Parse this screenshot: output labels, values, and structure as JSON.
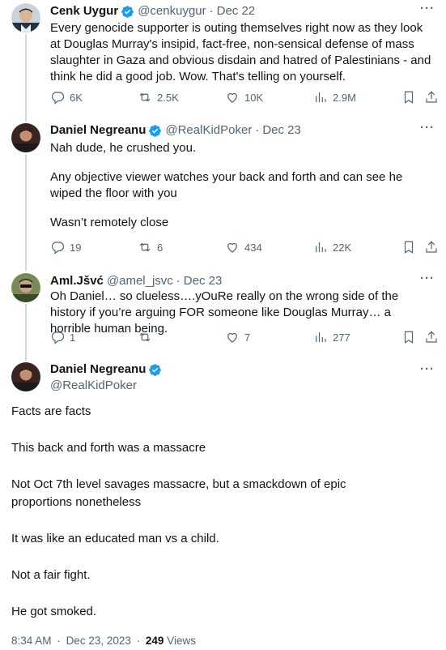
{
  "tweets": [
    {
      "name": "Cenk Uygur",
      "handle": "@cenkuygur",
      "sep": "·",
      "date": "Dec 22",
      "body": [
        "Every genocide supporter is outing themselves right now as they look at Douglas Murray's insipid, fact-free, non-sensical defense of mass slaughter in Gaza and obvious disdain and hatred of Palestinians - and think he did a good job. Wow. That's telling on yourself."
      ],
      "replies": "6K",
      "reposts": "2.5K",
      "likes": "10K",
      "views": "2.9M"
    },
    {
      "name": "Daniel Negreanu",
      "handle": "@RealKidPoker",
      "sep": "·",
      "date": "Dec 23",
      "body": [
        "Nah dude, he crushed you.",
        "Any objective viewer watches your back and forth and can see he wiped the floor with you",
        "Wasn’t remotely close"
      ],
      "replies": "19",
      "reposts": "6",
      "likes": "434",
      "views": "22K"
    },
    {
      "name": "Aml.Jšvć",
      "handle": "@amel_jsvc",
      "sep": "·",
      "date": "Dec 23",
      "body": [
        "Oh Daniel… so clueless….yOuRe really on the wrong side of the history if you’re arguing FOR someone like Douglas Murray… a horrible human being."
      ],
      "replies": "1",
      "reposts": "",
      "likes": "7",
      "views": "277"
    }
  ],
  "main": {
    "name": "Daniel Negreanu",
    "handle": "@RealKidPoker",
    "body": [
      "Facts are facts",
      "This back and forth was a massacre",
      "Not Oct 7th level savages massacre, but a smackdown of epic proportions nonetheless",
      "It was like an educated man vs a child.",
      "Not a fair fight.",
      "He got smoked."
    ],
    "time": "8:34 AM",
    "sep": "·",
    "date": "Dec 23, 2023",
    "views_count": "249",
    "views_label": "Views"
  },
  "more_glyph": "···",
  "colors": {
    "verified": "#1d9bf0",
    "muted": "#536471",
    "text": "#0f1419",
    "line": "#cfd9de"
  }
}
